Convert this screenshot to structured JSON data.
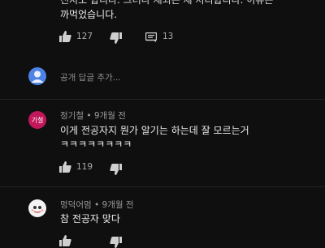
{
  "top_comment": {
    "text_line1": "진지도 합니다. 그러나 제외는 제 처리합니다. 이유는",
    "text_line2": "까먹었습니다.",
    "likes": "127",
    "replies": "13"
  },
  "reply_box": {
    "placeholder": "공개 답글 추가..."
  },
  "comments": [
    {
      "avatar_text": "기철",
      "author": "정기철",
      "time": "9개월 전",
      "text_line1": "이게 전공자지 뭔가 알기는 하는데 잘 모르는거",
      "text_line2": "ㅋㅋㅋㅋㅋㅋㅋㅋ",
      "likes": "119"
    },
    {
      "author": "멍덕어멈",
      "time": "9개월 전",
      "text_line1": "참 전공자 맞다"
    }
  ],
  "icons": {
    "like": "thumbs-up-icon",
    "dislike": "thumbs-down-icon",
    "reply": "comment-icon",
    "user": "user-icon"
  },
  "colors": {
    "background": "#0f0f0f",
    "avatar_blue": "#4e83e6",
    "avatar_pink": "#c2185b"
  }
}
